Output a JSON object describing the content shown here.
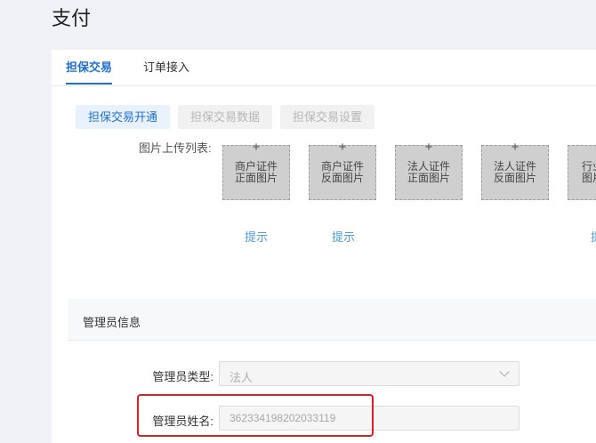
{
  "page": {
    "title": "支付"
  },
  "tabs": [
    {
      "label": "担保交易"
    },
    {
      "label": "订单接入"
    }
  ],
  "subtabs": [
    {
      "label": "担保交易开通"
    },
    {
      "label": "担保交易数据"
    },
    {
      "label": "担保交易设置"
    }
  ],
  "upload": {
    "label": "图片上传列表:",
    "items": [
      {
        "line1": "商户证件",
        "line2": "正面图片"
      },
      {
        "line1": "商户证件",
        "line2": "反面图片"
      },
      {
        "line1": "法人证件",
        "line2": "正面图片"
      },
      {
        "line1": "法人证件",
        "line2": "反面图片"
      },
      {
        "line1": "行业",
        "line2": "图片"
      }
    ],
    "hints": [
      "提示",
      "提示",
      "提"
    ]
  },
  "admin": {
    "section_title": "管理员信息",
    "type_label": "管理员类型:",
    "type_value": "法人",
    "name_label": "管理员姓名:",
    "name_value": "362334198202033119"
  },
  "colors": {
    "accent": "#1f6fd6",
    "highlight": "#e02020",
    "hint": "#4a9be0"
  }
}
